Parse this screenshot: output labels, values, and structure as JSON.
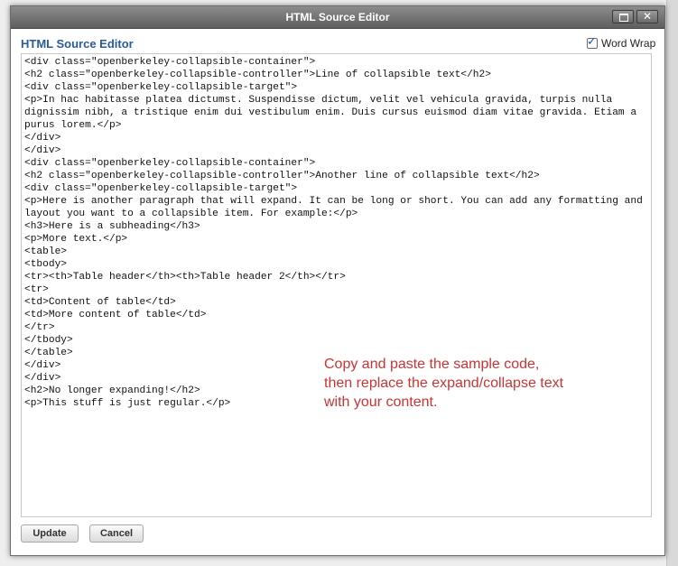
{
  "window": {
    "title": "HTML Source Editor"
  },
  "header": {
    "title": "HTML Source Editor"
  },
  "word_wrap": {
    "label": "Word Wrap",
    "checked": true
  },
  "editor": {
    "source": "<div class=\"openberkeley-collapsible-container\">\n<h2 class=\"openberkeley-collapsible-controller\">Line of collapsible text</h2>\n<div class=\"openberkeley-collapsible-target\">\n<p>In hac habitasse platea dictumst. Suspendisse dictum, velit vel vehicula gravida, turpis nulla dignissim nibh, a tristique enim dui vestibulum enim. Duis cursus euismod diam vitae gravida. Etiam a purus lorem.</p>\n</div>\n</div>\n<div class=\"openberkeley-collapsible-container\">\n<h2 class=\"openberkeley-collapsible-controller\">Another line of collapsible text</h2>\n<div class=\"openberkeley-collapsible-target\">\n<p>Here is another paragraph that will expand. It can be long or short. You can add any formatting and layout you want to a collapsible item. For example:</p>\n<h3>Here is a subheading</h3>\n<p>More text.</p>\n<table>\n<tbody>\n<tr><th>Table header</th><th>Table header 2</th></tr>\n<tr>\n<td>Content of table</td>\n<td>More content of table</td>\n</tr>\n</tbody>\n</table>\n</div>\n</div>\n<h2>No longer expanding!</h2>\n<p>This stuff is just regular.</p>"
  },
  "annotation": {
    "line1": "Copy and paste the sample code,",
    "line2": "then replace the expand/collapse text",
    "line3": "with your content."
  },
  "buttons": {
    "update": "Update",
    "cancel": "Cancel"
  },
  "icons": {
    "maximize": "maximize-icon",
    "close": "close-icon",
    "checkbox_check": "checkmark-icon"
  },
  "colors": {
    "title_blue": "#2b5b9a",
    "annotation_red": "#cc3333",
    "titlebar_gray": "#6e6e6e"
  }
}
